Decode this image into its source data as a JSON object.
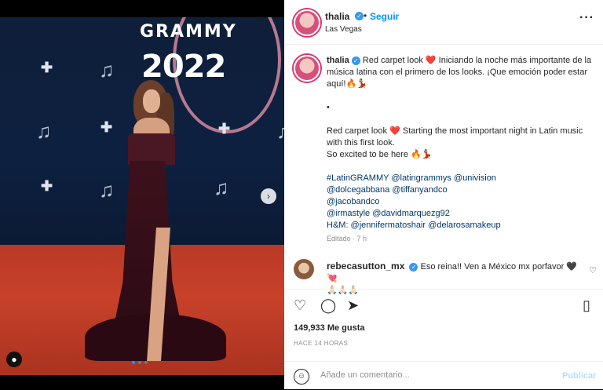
{
  "post": {
    "header": {
      "username": "thalia",
      "separator": "•",
      "follow_label": "Seguir",
      "location": "Las Vegas",
      "more_icon": "more-horizontal-icon"
    },
    "image": {
      "logo_word": "GRAMMY",
      "logo_year": "2022",
      "nav_next_icon": "chevron-right-icon",
      "user_tag_icon": "user-icon",
      "carousel_count": 3,
      "carousel_active": 1
    },
    "caption": {
      "username": "thalia",
      "lines": [
        "Red carpet look ❤️ Iniciando la noche más importante de la música latina con el primero de los looks. ¡Que emoción poder estar aquí!🔥💃🏻",
        "",
        "•",
        "",
        "Red carpet look ❤️ Starting the most important night in Latin music with this first look.",
        "So excited to be here 🔥💃🏻",
        "",
        "#LatinGRAMMY @latingrammys @univision",
        "@dolcegabbana @tiffanyandco",
        "@jacobandco",
        "@irmastyle @davidmarquezg92",
        "H&M: @jennifermatoshair @delarosamakeup"
      ],
      "edited": "Editado · 7 h"
    },
    "comment": {
      "username": "rebecasutton_mx",
      "text": "Eso reina!! Ven a México mx porfavor 🖤💘",
      "second_line": "🙏🏻🙏🏻🙏🏻"
    },
    "actions": {
      "like_icon": "heart-icon",
      "comment_icon": "comment-icon",
      "share_icon": "send-icon",
      "save_icon": "bookmark-icon"
    },
    "likes": "149,933 Me gusta",
    "time": "HACE 14 HORAS",
    "add_comment": {
      "placeholder": "Añade un comentario...",
      "publish_label": "Publicar",
      "emoji_icon": "smile-icon"
    }
  }
}
